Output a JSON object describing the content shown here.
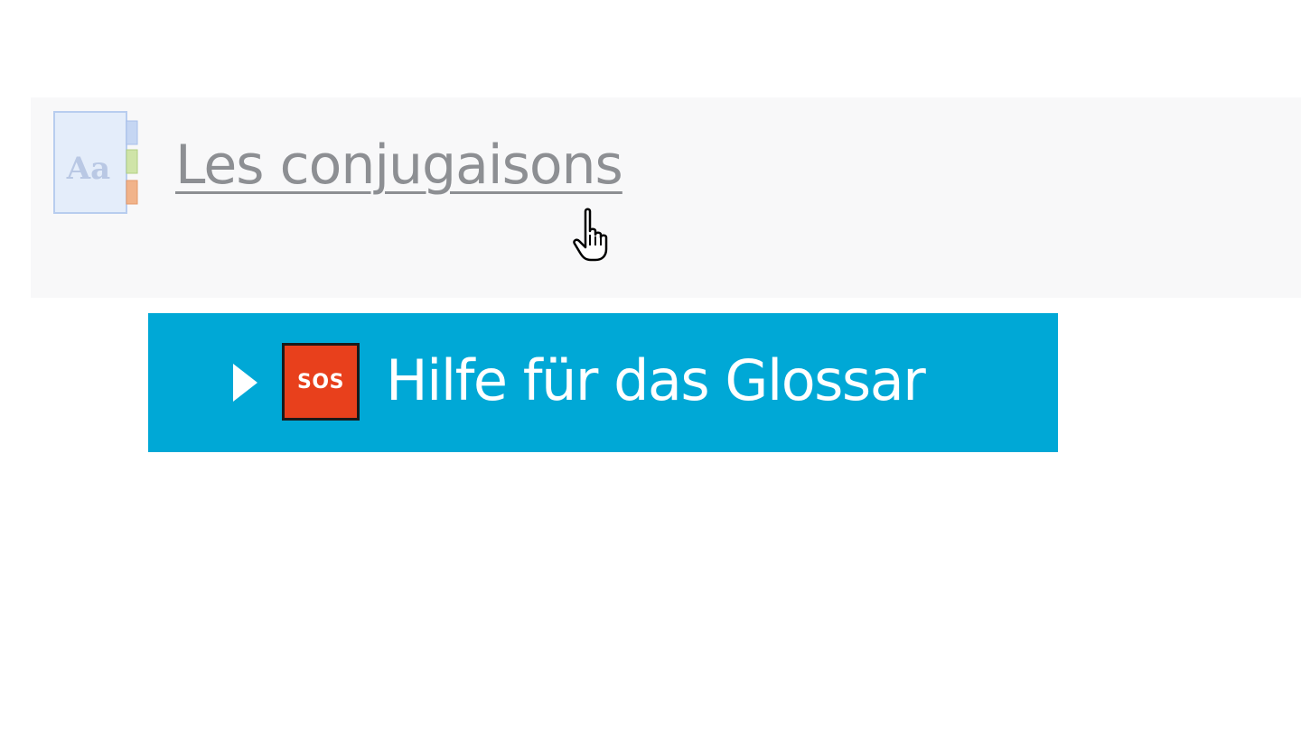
{
  "activity": {
    "title": "Les conjugaisons",
    "icon": "glossary-icon",
    "icon_label": "Aa"
  },
  "help": {
    "toggle_icon": "caret-right-icon",
    "badge_text": "SOS",
    "label": "Hilfe für das Glossar",
    "background_color": "#00a8d6",
    "badge_color": "#e8401c"
  },
  "cursor": {
    "icon": "hand-pointer-icon"
  }
}
